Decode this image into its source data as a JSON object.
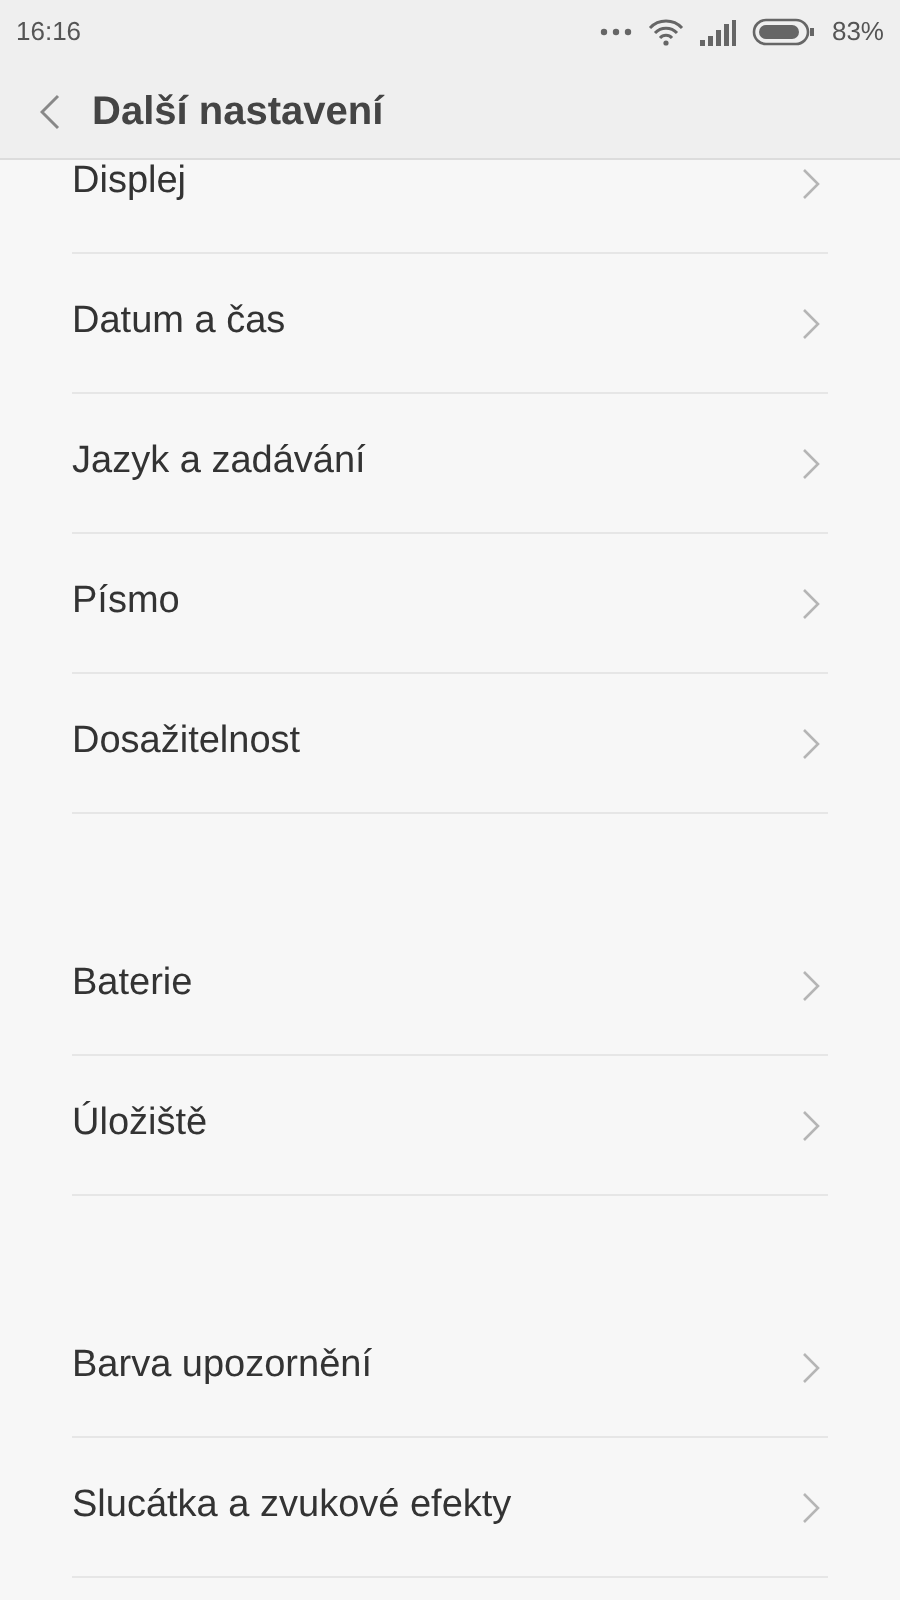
{
  "status_bar": {
    "time": "16:16",
    "battery": "83%"
  },
  "header": {
    "title": "Další nastavení"
  },
  "sections": [
    {
      "items": [
        {
          "label": "Displej"
        },
        {
          "label": "Datum a čas"
        },
        {
          "label": "Jazyk a zadávání"
        },
        {
          "label": "Písmo"
        },
        {
          "label": "Dosažitelnost"
        }
      ]
    },
    {
      "items": [
        {
          "label": "Baterie"
        },
        {
          "label": "Úložiště"
        }
      ]
    },
    {
      "items": [
        {
          "label": "Barva upozornění"
        },
        {
          "label": "Slucátka a zvukové efekty"
        }
      ]
    }
  ]
}
